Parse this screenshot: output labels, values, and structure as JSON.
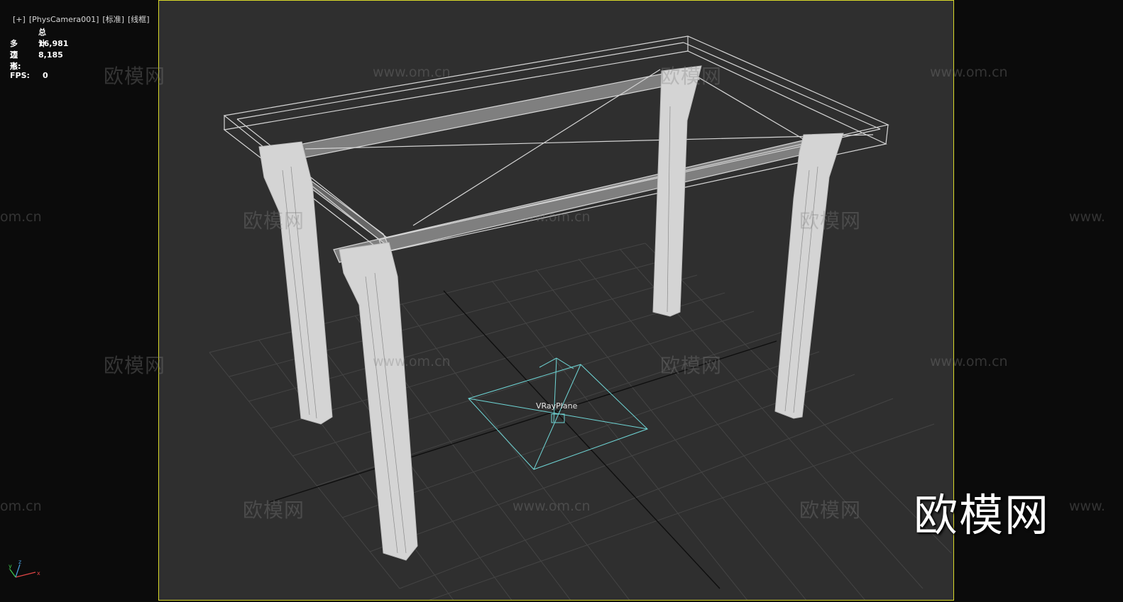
{
  "viewport": {
    "labels": [
      "[+]",
      "[PhysCamera001]",
      "[标准]",
      "[线框]"
    ],
    "border_color": "#d9d92a",
    "background_color": "#2f2f2f"
  },
  "stats": {
    "header": "总计",
    "polys_label": "多边形:",
    "polys_value": "16,981",
    "verts_label": "顶点:",
    "verts_value": "8,185",
    "fps_label": "FPS:",
    "fps_value": "0"
  },
  "scene": {
    "object_label": "VRayPlane",
    "wire_color": "#d0d0d0",
    "plane_color": "#6fd6d6",
    "grid_color": "#3e3e3e"
  },
  "gizmo": {
    "x_label": "x",
    "y_label": "y",
    "z_label": "z",
    "icon": "axis-tripod-icon"
  },
  "watermarks": {
    "cn": "欧模网",
    "url": "www.om.cn",
    "url_short": "om.cn",
    "url_www": "www."
  },
  "logo": {
    "text": "欧模网"
  }
}
